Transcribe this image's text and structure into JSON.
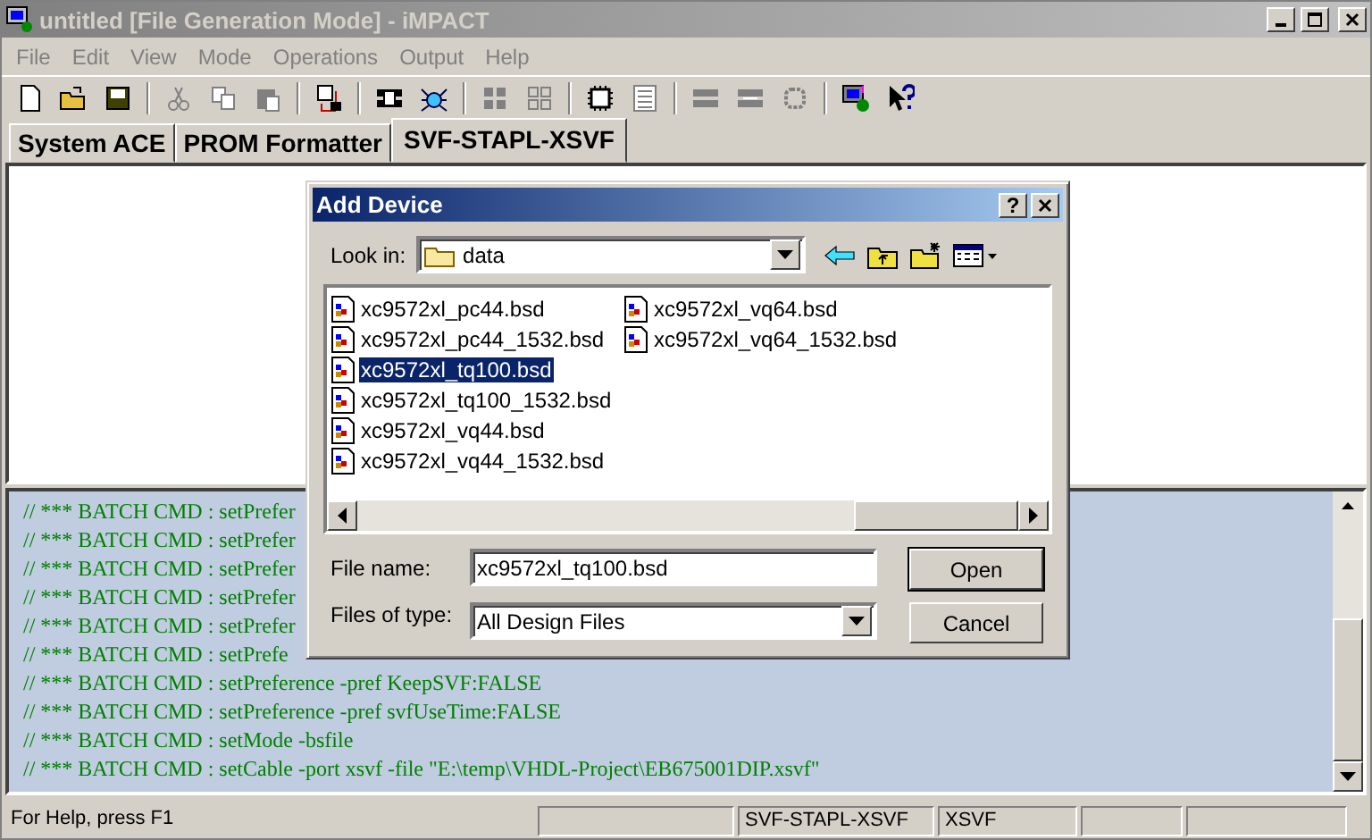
{
  "window": {
    "title": "untitled [File Generation Mode]  - iMPACT"
  },
  "menu": [
    "File",
    "Edit",
    "View",
    "Mode",
    "Operations",
    "Output",
    "Help"
  ],
  "tabs": [
    {
      "label": "System ACE",
      "selected": false
    },
    {
      "label": "PROM Formatter",
      "selected": false
    },
    {
      "label": "SVF-STAPL-XSVF",
      "selected": true
    }
  ],
  "log": [
    "// *** BATCH CMD : setPrefer",
    "// *** BATCH CMD : setPrefer",
    "// *** BATCH CMD : setPrefer",
    "// *** BATCH CMD : setPrefer",
    "// *** BATCH CMD : setPrefer",
    "// *** BATCH CMD : setPrefe",
    "// *** BATCH CMD : setPreference -pref KeepSVF:FALSE",
    "// *** BATCH CMD : setPreference -pref svfUseTime:FALSE",
    "// *** BATCH CMD : setMode -bsfile",
    "// *** BATCH CMD : setCable -port xsvf -file \"E:\\temp\\VHDL-Project\\EB675001DIP.xsvf\""
  ],
  "status_bar": {
    "help": "For Help, press F1",
    "mode": "SVF-STAPL-XSVF",
    "format": "XSVF"
  },
  "dialog": {
    "title": "Add Device",
    "help_button": "?",
    "look_in_label": "Look in:",
    "look_in": "data",
    "files": [
      {
        "name": "xc9572xl_pc44.bsd",
        "selected": false
      },
      {
        "name": "xc9572xl_pc44_1532.bsd",
        "selected": false
      },
      {
        "name": "xc9572xl_tq100.bsd",
        "selected": true
      },
      {
        "name": "xc9572xl_tq100_1532.bsd",
        "selected": false
      },
      {
        "name": "xc9572xl_vq44.bsd",
        "selected": false
      },
      {
        "name": "xc9572xl_vq44_1532.bsd",
        "selected": false
      },
      {
        "name": "xc9572xl_vq64.bsd",
        "selected": false
      },
      {
        "name": "xc9572xl_vq64_1532.bsd",
        "selected": false
      }
    ],
    "file_name_label": "File name:",
    "file_name": "xc9572xl_tq100.bsd",
    "file_type_label": "Files of type:",
    "file_type": "All Design Files",
    "buttons": [
      "Open",
      "Cancel"
    ]
  }
}
